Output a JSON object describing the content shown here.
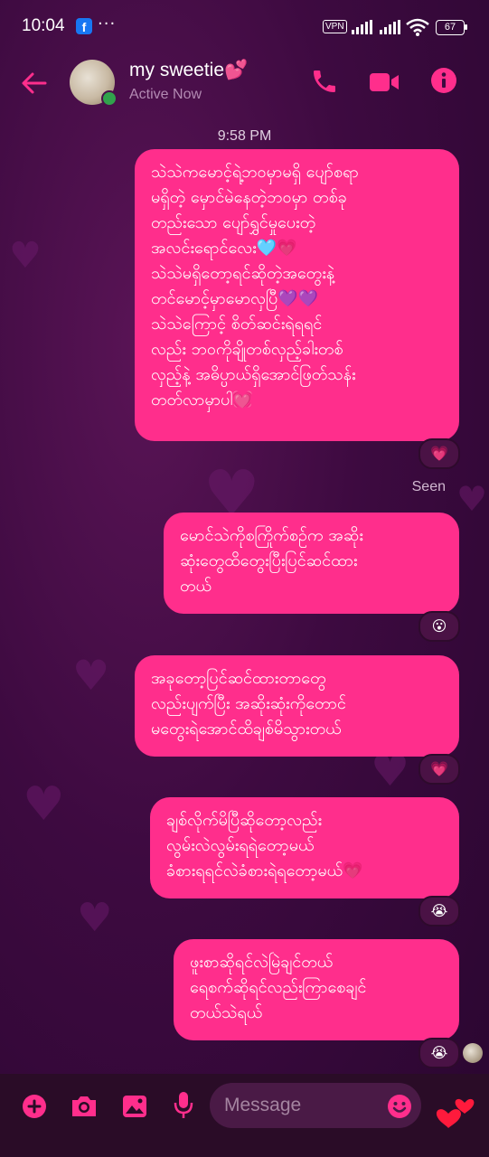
{
  "status_bar": {
    "time": "10:04",
    "facebook_badge": "f",
    "more_dots": "···",
    "vpn": "VPN",
    "battery": "67"
  },
  "header": {
    "contact_name": "my sweetie💕",
    "status": "Active Now",
    "icons": [
      "back-arrow-icon",
      "phone-icon",
      "video-camera-icon",
      "info-icon"
    ]
  },
  "conversation": {
    "timestamp": "9:58 PM",
    "seen_label": "Seen",
    "messages": [
      {
        "text": "သဲသဲကမောင့်ရဲ့ဘဝမှာမရှိ ပျော်စရာ\nမရှိတဲ့ မှောင်မဲနေတဲ့ဘဝမှာ တစ်ခု\nတည်းသော ပျော်ရွှင်မှုပေးတဲ့\nအလင်းရောင်လေး🩵💗\nသဲသဲမရှိတော့ရင်ဆိုတဲ့အတွေးနဲ့\nတင်မောင့်မှာမောလှပြီ💜💜\nသဲသဲကြောင့် စိတ်ဆင်းရဲရရင်\nလည်း ဘဝကိုချိုတစ်လှည့်ခါးတစ်\nလှည့်နဲ့ အဓိပ္ပာယ်ရှိအောင်ဖြတ်သန်း\nတတ်လာမှာပါ💓",
        "reaction": "💗"
      },
      {
        "text": "မောင်သဲကိုစကြိုက်စဉ်က အဆိုး\nဆုံးတွေထိတွေးပြီးပြင်ဆင်ထား\nတယ်",
        "reaction": "😮"
      },
      {
        "text": "အခုတော့ပြင်ဆင်ထားတာတွေ\nလည်းပျက်ပြီး အဆိုးဆုံးကိုတောင်\nမတွေးရဲအောင်ထိချစ်မိသွားတယ်",
        "reaction": "💗"
      },
      {
        "text": "ချစ်လိုက်မိပြီဆိုတော့လည်း\nလွမ်းလဲလွမ်းရရဲတော့မယ်\nခံစားရရင်လဲခံစားရဲရတော့မယ်💗",
        "reaction": "😭"
      },
      {
        "text": "ဖူးစာဆိုရင်လဲမြဲချင်တယ်\nရေစက်ဆိုရင်လည်းကြာစေချင်\nတယ်သဲရယ်",
        "reaction": "😭"
      }
    ]
  },
  "composer": {
    "placeholder": "Message",
    "icons": [
      "plus-icon",
      "camera-icon",
      "image-icon",
      "microphone-icon",
      "emoji-icon",
      "hearts-icon"
    ]
  },
  "colors": {
    "bubble": "#ff2e8c",
    "accent": "#ff2e8c",
    "background": "#3d0a40"
  }
}
